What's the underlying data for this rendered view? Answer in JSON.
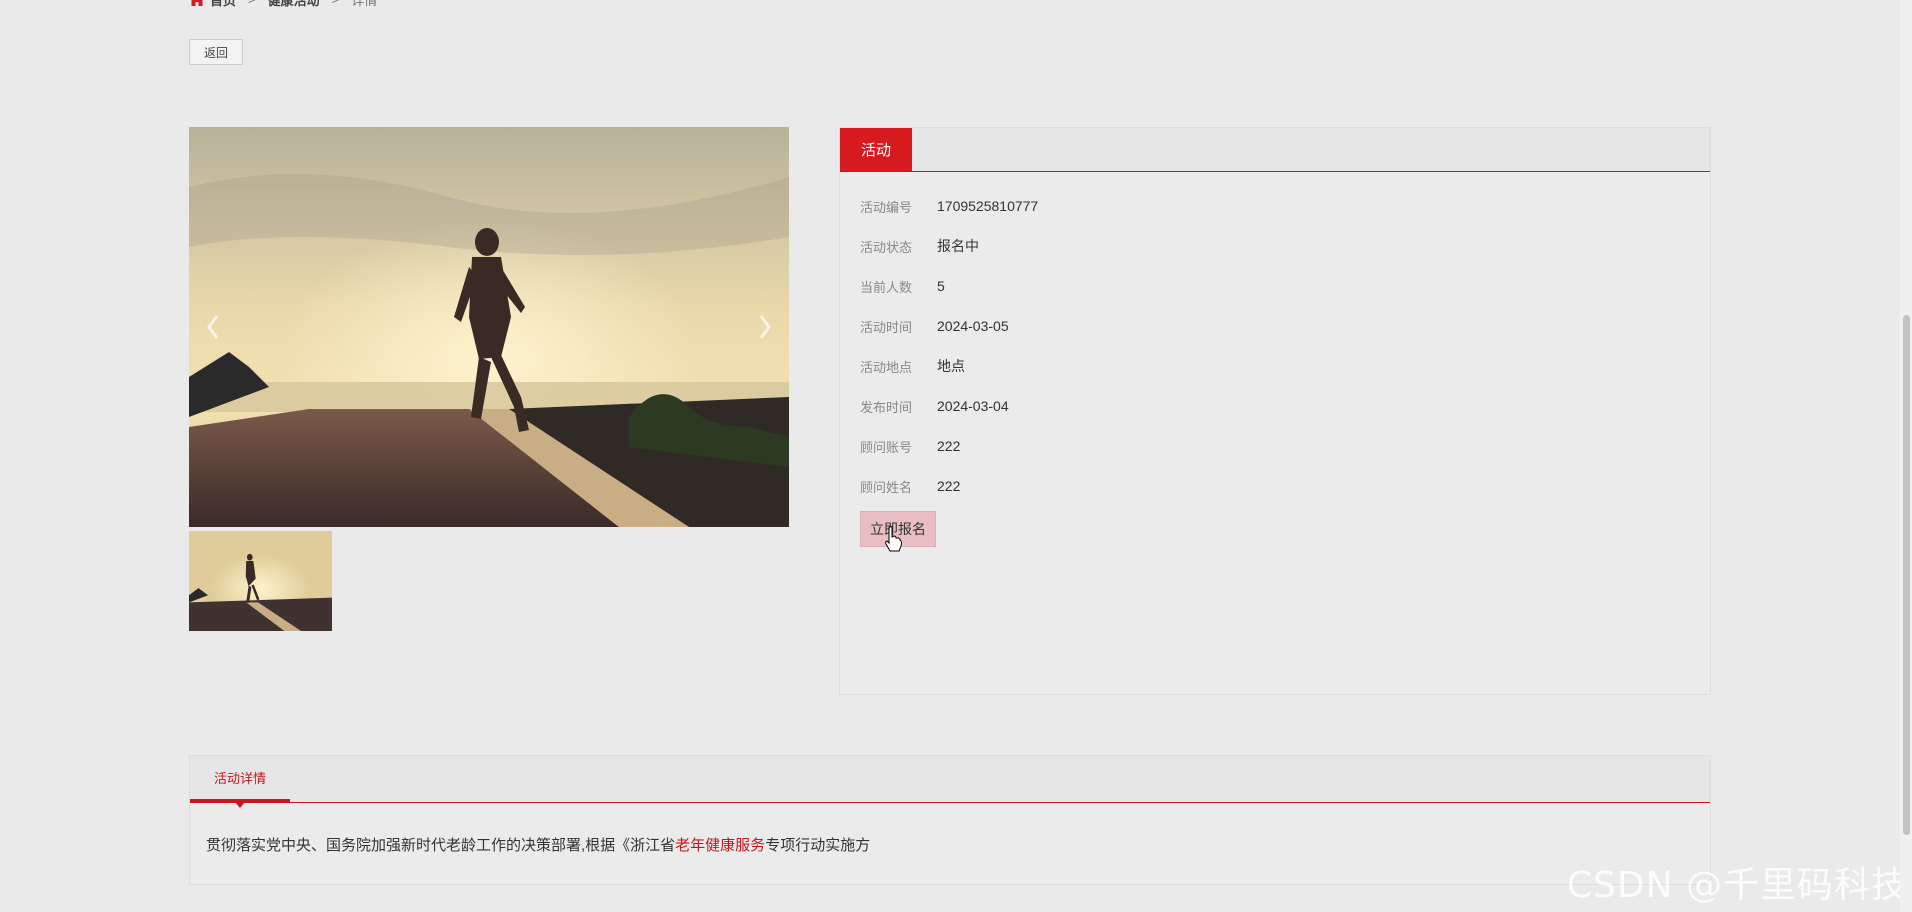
{
  "breadcrumb": {
    "items": [
      "首页",
      "健康活动",
      "详情"
    ],
    "separator": ">"
  },
  "back_button": {
    "label": "返回"
  },
  "gallery": {
    "main_image": "runner-sunset-photo",
    "thumbnails": [
      "runner-sunset-photo"
    ]
  },
  "info_panel": {
    "tab": "活动",
    "fields": [
      {
        "label": "活动编号",
        "value": "1709525810777"
      },
      {
        "label": "活动状态",
        "value": "报名中"
      },
      {
        "label": "当前人数",
        "value": "5"
      },
      {
        "label": "活动时间",
        "value": "2024-03-05"
      },
      {
        "label": "活动地点",
        "value": "地点"
      },
      {
        "label": "发布时间",
        "value": "2024-03-04"
      },
      {
        "label": "顾问账号",
        "value": "222"
      },
      {
        "label": "顾问姓名",
        "value": "222"
      }
    ],
    "signup_button": "立即报名"
  },
  "detail_panel": {
    "tab": "活动详情",
    "text_before": "贯彻落实党中央、国务院加强新时代老龄工作的决策部署,根据《浙江省",
    "text_highlight": "老年健康服务",
    "text_after": "专项行动实施方"
  },
  "watermark": "CSDN @千里码科技",
  "colors": {
    "accent": "#d71920",
    "background": "#eaeaea",
    "signup_button": "#e8bec2"
  }
}
